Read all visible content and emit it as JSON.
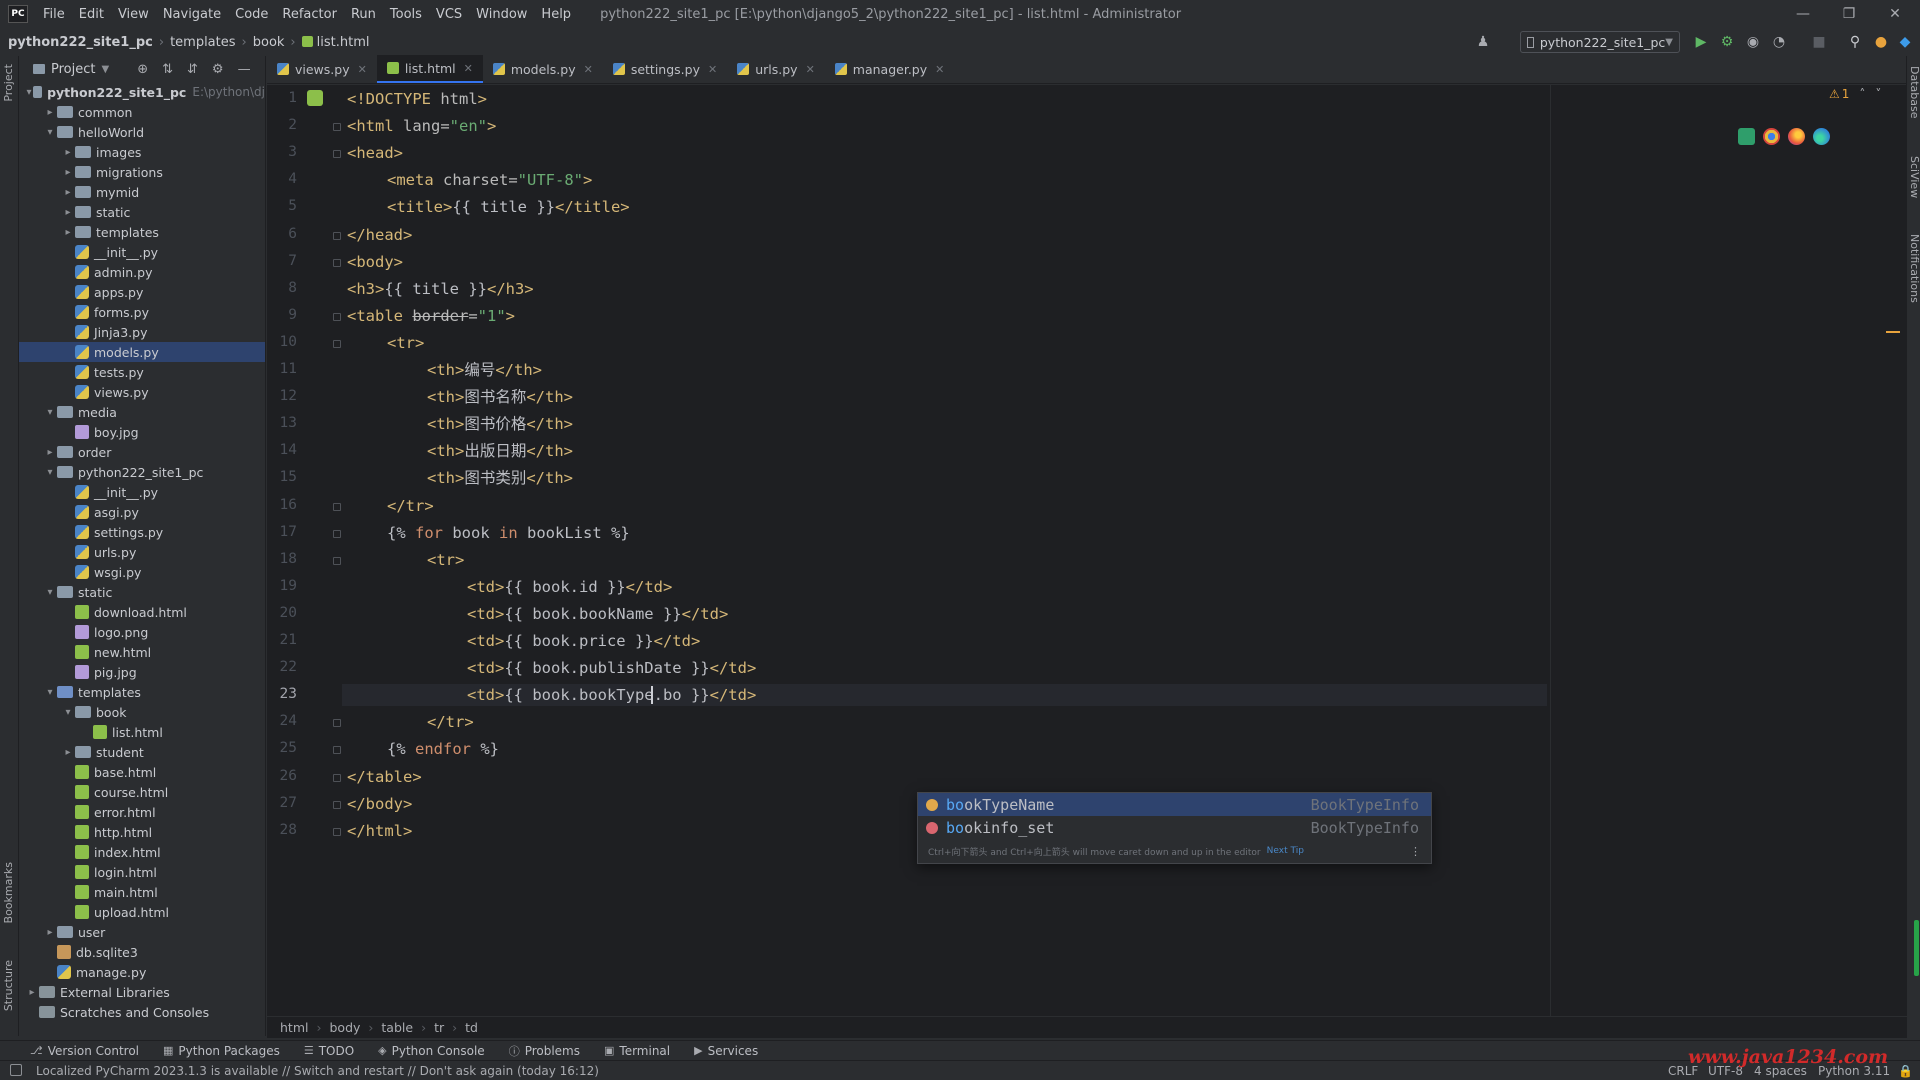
{
  "app": {
    "logo": "PC",
    "menu": [
      "File",
      "Edit",
      "View",
      "Navigate",
      "Code",
      "Refactor",
      "Run",
      "Tools",
      "VCS",
      "Window",
      "Help"
    ],
    "window_title": "python222_site1_pc [E:\\python\\django5_2\\python222_site1_pc] - list.html - Administrator"
  },
  "nav": {
    "breadcrumb": [
      "python222_site1_pc",
      "templates",
      "book",
      "list.html"
    ],
    "run_config": "python222_site1_pc"
  },
  "project": {
    "header": "Project",
    "tree": [
      {
        "level": 0,
        "type": "folder",
        "open": true,
        "name": "python222_site1_pc",
        "hint": "E:\\python\\dj"
      },
      {
        "level": 1,
        "type": "folder",
        "open": false,
        "name": "common"
      },
      {
        "level": 1,
        "type": "folder",
        "open": true,
        "name": "helloWorld"
      },
      {
        "level": 2,
        "type": "folder",
        "open": false,
        "name": "images"
      },
      {
        "level": 2,
        "type": "folder",
        "open": false,
        "name": "migrations"
      },
      {
        "level": 2,
        "type": "folder",
        "open": false,
        "name": "mymid"
      },
      {
        "level": 2,
        "type": "folder",
        "open": false,
        "name": "static"
      },
      {
        "level": 2,
        "type": "folder",
        "open": false,
        "name": "templates"
      },
      {
        "level": 2,
        "type": "py",
        "name": "__init__.py"
      },
      {
        "level": 2,
        "type": "py",
        "name": "admin.py"
      },
      {
        "level": 2,
        "type": "py",
        "name": "apps.py"
      },
      {
        "level": 2,
        "type": "py",
        "name": "forms.py"
      },
      {
        "level": 2,
        "type": "py",
        "name": "Jinja3.py"
      },
      {
        "level": 2,
        "type": "py",
        "name": "models.py",
        "selected": true
      },
      {
        "level": 2,
        "type": "py",
        "name": "tests.py"
      },
      {
        "level": 2,
        "type": "py",
        "name": "views.py"
      },
      {
        "level": 1,
        "type": "folder",
        "open": true,
        "name": "media"
      },
      {
        "level": 2,
        "type": "img",
        "name": "boy.jpg"
      },
      {
        "level": 1,
        "type": "folder",
        "open": false,
        "name": "order"
      },
      {
        "level": 1,
        "type": "folder",
        "open": true,
        "name": "python222_site1_pc"
      },
      {
        "level": 2,
        "type": "py",
        "name": "__init__.py"
      },
      {
        "level": 2,
        "type": "py",
        "name": "asgi.py"
      },
      {
        "level": 2,
        "type": "py",
        "name": "settings.py"
      },
      {
        "level": 2,
        "type": "py",
        "name": "urls.py"
      },
      {
        "level": 2,
        "type": "py",
        "name": "wsgi.py"
      },
      {
        "level": 1,
        "type": "folder",
        "open": true,
        "name": "static"
      },
      {
        "level": 2,
        "type": "html",
        "name": "download.html"
      },
      {
        "level": 2,
        "type": "img",
        "name": "logo.png"
      },
      {
        "level": 2,
        "type": "html",
        "name": "new.html"
      },
      {
        "level": 2,
        "type": "img",
        "name": "pig.jpg"
      },
      {
        "level": 1,
        "type": "folder",
        "open": true,
        "name": "templates",
        "accent": true
      },
      {
        "level": 2,
        "type": "folder",
        "open": true,
        "name": "book"
      },
      {
        "level": 3,
        "type": "html",
        "name": "list.html"
      },
      {
        "level": 2,
        "type": "folder",
        "open": false,
        "name": "student"
      },
      {
        "level": 2,
        "type": "html",
        "name": "base.html"
      },
      {
        "level": 2,
        "type": "html",
        "name": "course.html"
      },
      {
        "level": 2,
        "type": "html",
        "name": "error.html"
      },
      {
        "level": 2,
        "type": "html",
        "name": "http.html"
      },
      {
        "level": 2,
        "type": "html",
        "name": "index.html"
      },
      {
        "level": 2,
        "type": "html",
        "name": "login.html"
      },
      {
        "level": 2,
        "type": "html",
        "name": "main.html"
      },
      {
        "level": 2,
        "type": "html",
        "name": "upload.html"
      },
      {
        "level": 1,
        "type": "folder",
        "open": false,
        "name": "user"
      },
      {
        "level": 1,
        "type": "db",
        "name": "db.sqlite3"
      },
      {
        "level": 1,
        "type": "py",
        "name": "manage.py"
      },
      {
        "level": 0,
        "type": "lib",
        "open": false,
        "name": "External Libraries"
      },
      {
        "level": 0,
        "type": "scratch",
        "name": "Scratches and Consoles"
      }
    ]
  },
  "tabs": [
    {
      "label": "views.py",
      "kind": "py"
    },
    {
      "label": "list.html",
      "kind": "html",
      "active": true
    },
    {
      "label": "models.py",
      "kind": "py"
    },
    {
      "label": "settings.py",
      "kind": "py"
    },
    {
      "label": "urls.py",
      "kind": "py"
    },
    {
      "label": "manager.py",
      "kind": "py"
    }
  ],
  "editor": {
    "current_line": 23,
    "warnings": "1",
    "lines": [
      {
        "n": 1,
        "indent": 0,
        "tokens": [
          [
            "tag",
            "<!DOCTYPE "
          ],
          [
            "attr",
            "html"
          ],
          [
            "tag",
            ">"
          ]
        ]
      },
      {
        "n": 2,
        "indent": 0,
        "tokens": [
          [
            "tag",
            "<html "
          ],
          [
            "attr",
            "lang="
          ],
          [
            "str",
            "\"en\""
          ],
          [
            "tag",
            ">"
          ]
        ]
      },
      {
        "n": 3,
        "indent": 0,
        "tokens": [
          [
            "tag",
            "<head>"
          ]
        ]
      },
      {
        "n": 4,
        "indent": 4,
        "tokens": [
          [
            "tag",
            "<meta "
          ],
          [
            "attr",
            "charset="
          ],
          [
            "str",
            "\"UTF-8\""
          ],
          [
            "tag",
            ">"
          ]
        ]
      },
      {
        "n": 5,
        "indent": 4,
        "tokens": [
          [
            "tag",
            "<title>"
          ],
          [
            "txt",
            "{{ title }}"
          ],
          [
            "tag",
            "</title>"
          ]
        ]
      },
      {
        "n": 6,
        "indent": 0,
        "tokens": [
          [
            "tag",
            "</head>"
          ]
        ]
      },
      {
        "n": 7,
        "indent": 0,
        "tokens": [
          [
            "tag",
            "<body>"
          ]
        ]
      },
      {
        "n": 8,
        "indent": 0,
        "tokens": [
          [
            "tag",
            "<h3>"
          ],
          [
            "txt",
            "{{ title }}"
          ],
          [
            "tag",
            "</h3>"
          ]
        ]
      },
      {
        "n": 9,
        "indent": 0,
        "tokens": [
          [
            "tag",
            "<table "
          ],
          [
            "attr strike",
            "border"
          ],
          [
            "attr",
            "="
          ],
          [
            "str",
            "\"1\""
          ],
          [
            "tag",
            ">"
          ]
        ]
      },
      {
        "n": 10,
        "indent": 4,
        "tokens": [
          [
            "tag",
            "<tr>"
          ]
        ]
      },
      {
        "n": 11,
        "indent": 8,
        "tokens": [
          [
            "tag",
            "<th>"
          ],
          [
            "txt",
            "编号"
          ],
          [
            "tag",
            "</th>"
          ]
        ]
      },
      {
        "n": 12,
        "indent": 8,
        "tokens": [
          [
            "tag",
            "<th>"
          ],
          [
            "txt",
            "图书名称"
          ],
          [
            "tag",
            "</th>"
          ]
        ]
      },
      {
        "n": 13,
        "indent": 8,
        "tokens": [
          [
            "tag",
            "<th>"
          ],
          [
            "txt",
            "图书价格"
          ],
          [
            "tag",
            "</th>"
          ]
        ]
      },
      {
        "n": 14,
        "indent": 8,
        "tokens": [
          [
            "tag",
            "<th>"
          ],
          [
            "txt",
            "出版日期"
          ],
          [
            "tag",
            "</th>"
          ]
        ]
      },
      {
        "n": 15,
        "indent": 8,
        "tokens": [
          [
            "tag",
            "<th>"
          ],
          [
            "txt",
            "图书类别"
          ],
          [
            "tag",
            "</th>"
          ]
        ]
      },
      {
        "n": 16,
        "indent": 4,
        "tokens": [
          [
            "tag",
            "</tr>"
          ]
        ]
      },
      {
        "n": 17,
        "indent": 4,
        "tokens": [
          [
            "txt",
            "{% "
          ],
          [
            "kw",
            "for "
          ],
          [
            "txt",
            "book "
          ],
          [
            "kw",
            "in "
          ],
          [
            "txt",
            "bookList %}"
          ]
        ]
      },
      {
        "n": 18,
        "indent": 8,
        "tokens": [
          [
            "tag",
            "<tr>"
          ]
        ]
      },
      {
        "n": 19,
        "indent": 12,
        "tokens": [
          [
            "tag",
            "<td>"
          ],
          [
            "txt",
            "{{ book.id }}"
          ],
          [
            "tag",
            "</td>"
          ]
        ]
      },
      {
        "n": 20,
        "indent": 12,
        "tokens": [
          [
            "tag",
            "<td>"
          ],
          [
            "txt",
            "{{ book.bookName }}"
          ],
          [
            "tag",
            "</td>"
          ]
        ]
      },
      {
        "n": 21,
        "indent": 12,
        "tokens": [
          [
            "tag",
            "<td>"
          ],
          [
            "txt",
            "{{ book.price }}"
          ],
          [
            "tag",
            "</td>"
          ]
        ]
      },
      {
        "n": 22,
        "indent": 12,
        "tokens": [
          [
            "tag",
            "<td>"
          ],
          [
            "txt",
            "{{ book.publishDate }}"
          ],
          [
            "tag",
            "</td>"
          ]
        ]
      },
      {
        "n": 23,
        "indent": 12,
        "tokens": [
          [
            "tag",
            "<td>"
          ],
          [
            "txt",
            "{{ book.bookType.bo }}"
          ],
          [
            "tag",
            "</td>"
          ]
        ]
      },
      {
        "n": 24,
        "indent": 8,
        "tokens": [
          [
            "tag",
            "</tr>"
          ]
        ]
      },
      {
        "n": 25,
        "indent": 4,
        "tokens": [
          [
            "txt",
            "{% "
          ],
          [
            "kw",
            "endfor "
          ],
          [
            "txt",
            "%}"
          ]
        ]
      },
      {
        "n": 26,
        "indent": 0,
        "tokens": [
          [
            "tag",
            "</table>"
          ]
        ]
      },
      {
        "n": 27,
        "indent": 0,
        "tokens": [
          [
            "tag",
            "</body>"
          ]
        ]
      },
      {
        "n": 28,
        "indent": 0,
        "tokens": [
          [
            "tag",
            "</html>"
          ]
        ]
      }
    ]
  },
  "completion": {
    "items": [
      {
        "match": "bo",
        "rest": "okTypeName",
        "type": "BookTypeInfo",
        "icon_color": "#e0a84b",
        "selected": true
      },
      {
        "match": "bo",
        "rest": "okinfo_set",
        "type": "BookTypeInfo",
        "icon_color": "#d9666f"
      }
    ],
    "tip": "Ctrl+向下箭头 and Ctrl+向上箭头 will move caret down and up in the editor",
    "tip_link": "Next Tip"
  },
  "editor_breadcrumb": [
    "html",
    "body",
    "table",
    "tr",
    "td"
  ],
  "bottom_tools": [
    {
      "icon": "branch-icon",
      "label": "Version Control"
    },
    {
      "icon": "packages-icon",
      "label": "Python Packages"
    },
    {
      "icon": "list-icon",
      "label": "TODO"
    },
    {
      "icon": "python-console-icon",
      "label": "Python Console"
    },
    {
      "icon": "problems-icon",
      "label": "Problems"
    },
    {
      "icon": "terminal-icon",
      "label": "Terminal"
    },
    {
      "icon": "services-icon",
      "label": "Services"
    }
  ],
  "status": {
    "message": "Localized PyCharm 2023.1.3 is available // Switch and restart // Don't ask again (today 16:12)",
    "line_sep": "CRLF",
    "encoding": "UTF-8",
    "indent": "4 spaces",
    "interpreter": "Python 3.11"
  },
  "watermark": "www.java1234.com",
  "side_labels": {
    "left_top": "Project",
    "left_bookmarks": "Bookmarks",
    "left_structure": "Structure",
    "right_top": "Database",
    "right_sciview": "SciView",
    "right_notifications": "Notifications"
  },
  "colors": {
    "accent": "#3574f0",
    "editor_bg": "#1e1f22",
    "panel_bg": "#2b2d30",
    "tag": "#d5b778",
    "string": "#6aab73",
    "keyword": "#cf8e6d"
  }
}
